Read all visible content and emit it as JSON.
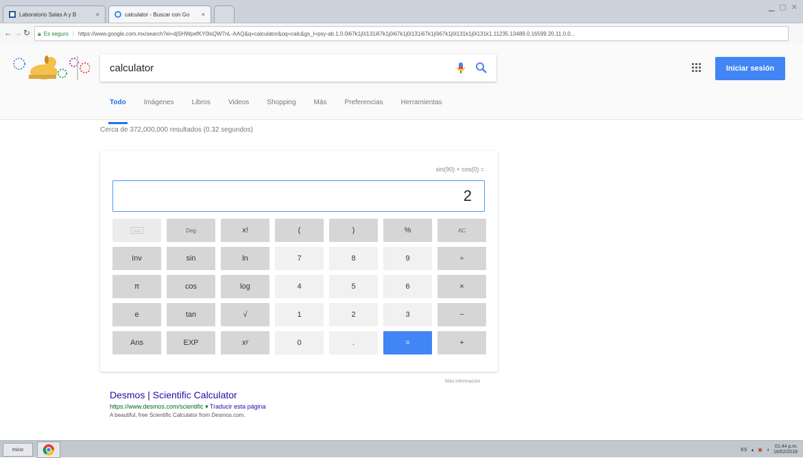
{
  "browser": {
    "tabs": [
      {
        "title": "Laboratorio Salas A y B",
        "active": false
      },
      {
        "title": "calculator - Buscar con Go",
        "active": true
      }
    ],
    "security_label": "Es seguro",
    "url": "https://www.google.com.mx/search?ei=djSHWpefKY0lsQW7nL-AAQ&q=calculator&oq=calc&gs_l=psy-ab.1.0.0i67k1j0i131i67k1j0i67k1j0i131i67k1j0i67k1j0i131k1j0i131k1.11235.13489.0.16599.20.11.0.0..."
  },
  "header": {
    "search_query": "calculator",
    "signin_label": "Iniciar sesión",
    "tabs": [
      "Todo",
      "Imágenes",
      "Libros",
      "Videos",
      "Shopping",
      "Más",
      "Preferencias",
      "Herramientas"
    ]
  },
  "stats": "Cerca de 372,000,000 resultados (0.32 segundos)",
  "calculator": {
    "expression": "sin(90) + cos(0) =",
    "display": "2",
    "keys": [
      [
        "",
        "Deg",
        "x!",
        "(",
        ")",
        "%",
        "AC"
      ],
      [
        "Inv",
        "sin",
        "ln",
        "7",
        "8",
        "9",
        "÷"
      ],
      [
        "π",
        "cos",
        "log",
        "4",
        "5",
        "6",
        "×"
      ],
      [
        "e",
        "tan",
        "√",
        "1",
        "2",
        "3",
        "−"
      ],
      [
        "Ans",
        "EXP",
        "xʸ",
        "0",
        ".",
        "=",
        "+"
      ]
    ],
    "more_info": "Más información"
  },
  "result": {
    "title": "Desmos | Scientific Calculator",
    "url": "https://www.desmos.com/scientific",
    "translate": "Traducir esta página",
    "desc": "A beautiful, free Scientific Calculator from Desmos.com."
  },
  "taskbar": {
    "start_label": "Inicio",
    "lang": "ES",
    "time": "01:44 p.m.",
    "date": "16/02/2018"
  }
}
